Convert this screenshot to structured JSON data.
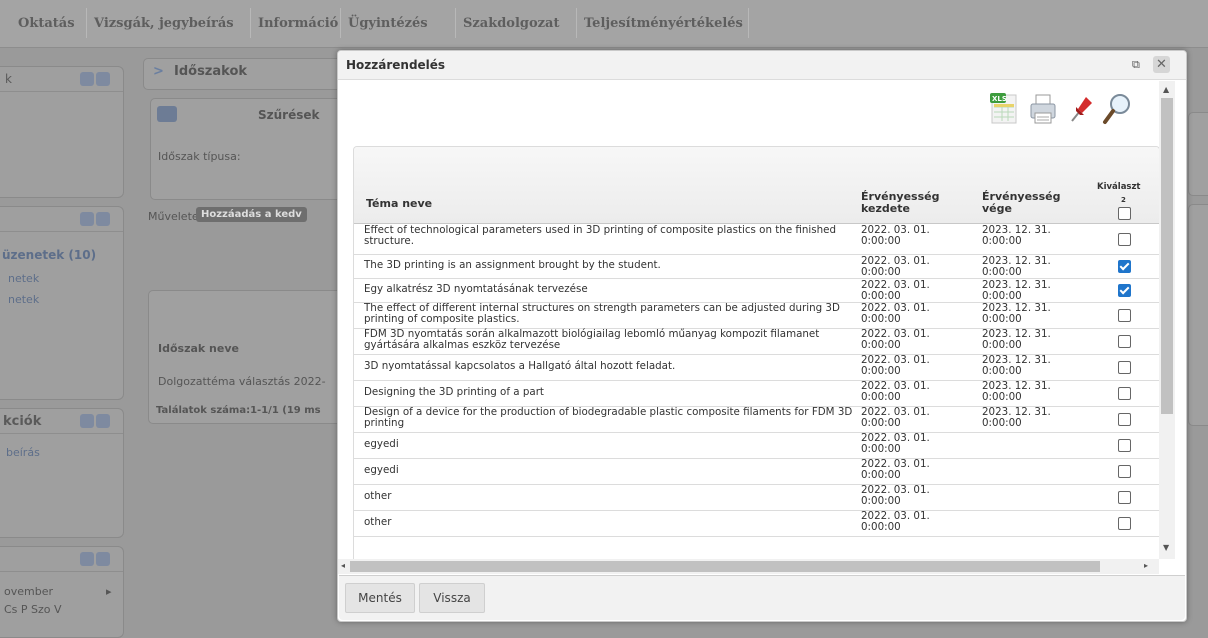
{
  "topnav": {
    "items": [
      "Oktatás",
      "Vizsgák, jegybeírás",
      "Információ",
      "Ügyintézés",
      "Szakdolgozat",
      "Teljesítményértékelés"
    ]
  },
  "background": {
    "panel1_title": "k",
    "panel2_items": [
      "üzenetek (10)",
      "netek",
      "netek"
    ],
    "panel3_title": "kciók",
    "panel3_items": [
      "beírás"
    ],
    "calendar_month": "ovember",
    "calendar_days": "Cs   P   Szo   V",
    "main_title": "Időszakok",
    "filters_label": "Szűrések",
    "period_type_label": "Időszak típusa:",
    "operations_label": "Műveletek:",
    "add_favorites": "Hozzáadás a kedv",
    "period_name_header": "Időszak neve",
    "period_row": "Dolgozattéma választás 2022-",
    "results_count": "Találatok száma:1-1/1 (19 ms"
  },
  "dialog": {
    "title": "Hozzárendelés",
    "toolbar_icons": [
      "excel-export-icon",
      "print-icon",
      "pin-icon",
      "search-icon"
    ],
    "columns": {
      "topic": "Téma neve",
      "valid_from": "Érvényesség kezdete",
      "valid_to": "Érvényesség vége",
      "select": "Kiválaszt",
      "select_count": "2"
    },
    "rows": [
      {
        "topic": "Effect of technological parameters used in 3D printing of composite plastics on the finished structure.",
        "from": "2022. 03. 01. 0:00:00",
        "to": "2023. 12. 31. 0:00:00",
        "checked": false
      },
      {
        "topic": "The 3D printing is an assignment brought by the student.",
        "from": "2022. 03. 01. 0:00:00",
        "to": "2023. 12. 31. 0:00:00",
        "checked": true
      },
      {
        "topic": "Egy alkatrész 3D nyomtatásának tervezése",
        "from": "2022. 03. 01. 0:00:00",
        "to": "2023. 12. 31. 0:00:00",
        "checked": true
      },
      {
        "topic": "The effect of different internal structures on strength parameters can be adjusted during 3D printing of composite plastics.",
        "from": "2022. 03. 01. 0:00:00",
        "to": "2023. 12. 31. 0:00:00",
        "checked": false
      },
      {
        "topic": "FDM 3D nyomtatás során alkalmazott biológiailag lebomló műanyag kompozit filamanet gyártására alkalmas eszköz tervezése",
        "from": "2022. 03. 01. 0:00:00",
        "to": "2023. 12. 31. 0:00:00",
        "checked": false
      },
      {
        "topic": "3D nyomtatással kapcsolatos a Hallgató által hozott feladat.",
        "from": "2022. 03. 01. 0:00:00",
        "to": "2023. 12. 31. 0:00:00",
        "checked": false
      },
      {
        "topic": "Designing the 3D printing of a part",
        "from": "2022. 03. 01. 0:00:00",
        "to": "2023. 12. 31. 0:00:00",
        "checked": false
      },
      {
        "topic": "Design of a device for the production of biodegradable plastic composite filaments for FDM 3D printing",
        "from": "2022. 03. 01. 0:00:00",
        "to": "2023. 12. 31. 0:00:00",
        "checked": false
      },
      {
        "topic": "egyedi",
        "from": "2022. 03. 01. 0:00:00",
        "to": "",
        "checked": false
      },
      {
        "topic": "egyedi",
        "from": "2022. 03. 01. 0:00:00",
        "to": "",
        "checked": false
      },
      {
        "topic": "other",
        "from": "2022. 03. 01. 0:00:00",
        "to": "",
        "checked": false
      },
      {
        "topic": "other",
        "from": "2022. 03. 01. 0:00:00",
        "to": "",
        "checked": false
      }
    ],
    "buttons": {
      "save": "Mentés",
      "back": "Vissza"
    }
  },
  "colors": {
    "checkbox_checked": "#1f75cb",
    "overlay": "#9a9a9a"
  }
}
